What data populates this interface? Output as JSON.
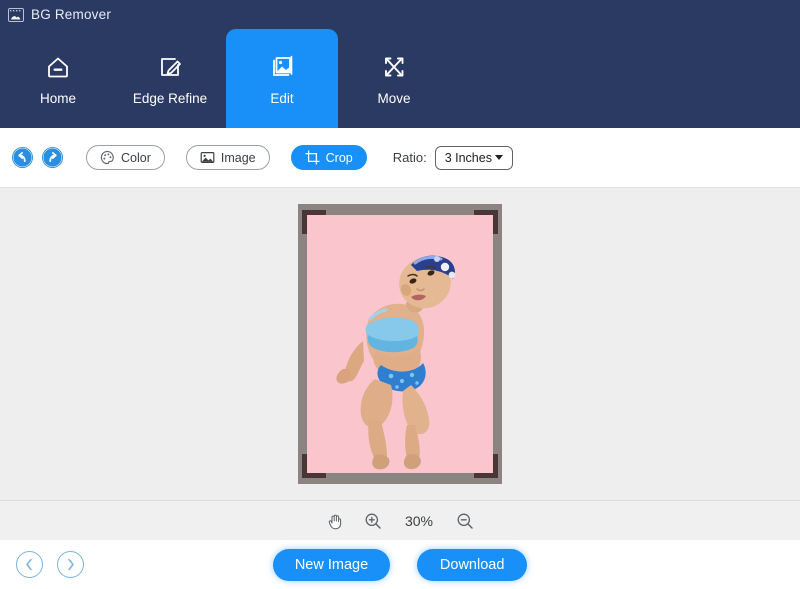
{
  "window": {
    "title": "BG Remover",
    "icon": "image-app-icon",
    "header_bg": "#2b3a62",
    "accent": "#1890f8"
  },
  "tabs": [
    {
      "label": "Home",
      "icon": "home-icon",
      "active": false
    },
    {
      "label": "Edge Refine",
      "icon": "edge-refine-pen-icon",
      "active": false
    },
    {
      "label": "Edit",
      "icon": "edit-image-icon",
      "active": true
    },
    {
      "label": "Move",
      "icon": "move-arrows-icon",
      "active": false
    }
  ],
  "toolbar": {
    "undo": {
      "name": "undo-button",
      "icon": "undo-arrow-icon"
    },
    "redo": {
      "name": "redo-button",
      "icon": "redo-arrow-icon"
    },
    "color_label": "Color",
    "color_icon": "palette-icon",
    "image_label": "Image",
    "image_icon": "picture-icon",
    "crop_label": "Crop",
    "crop_icon": "crop-icon",
    "crop_active": true,
    "ratio_label": "Ratio:",
    "ratio_value": "3 Inches",
    "ratio_options": [
      "3 Inches"
    ]
  },
  "canvas": {
    "frame_color": "#8c8480",
    "photo_background": "#fbc5cd",
    "crop_handle_color": "#4a3634",
    "background": "#eeeeee",
    "subject_alt": "child in blue swimsuit on pink background"
  },
  "zoom": {
    "hand_icon": "hand-pan-icon",
    "zoom_in_icon": "zoom-in-icon",
    "zoom_out_icon": "zoom-out-icon",
    "level": "30%"
  },
  "bottom": {
    "prev_icon": "chevron-left-icon",
    "next_icon": "chevron-right-icon",
    "new_image_label": "New Image",
    "download_label": "Download"
  }
}
